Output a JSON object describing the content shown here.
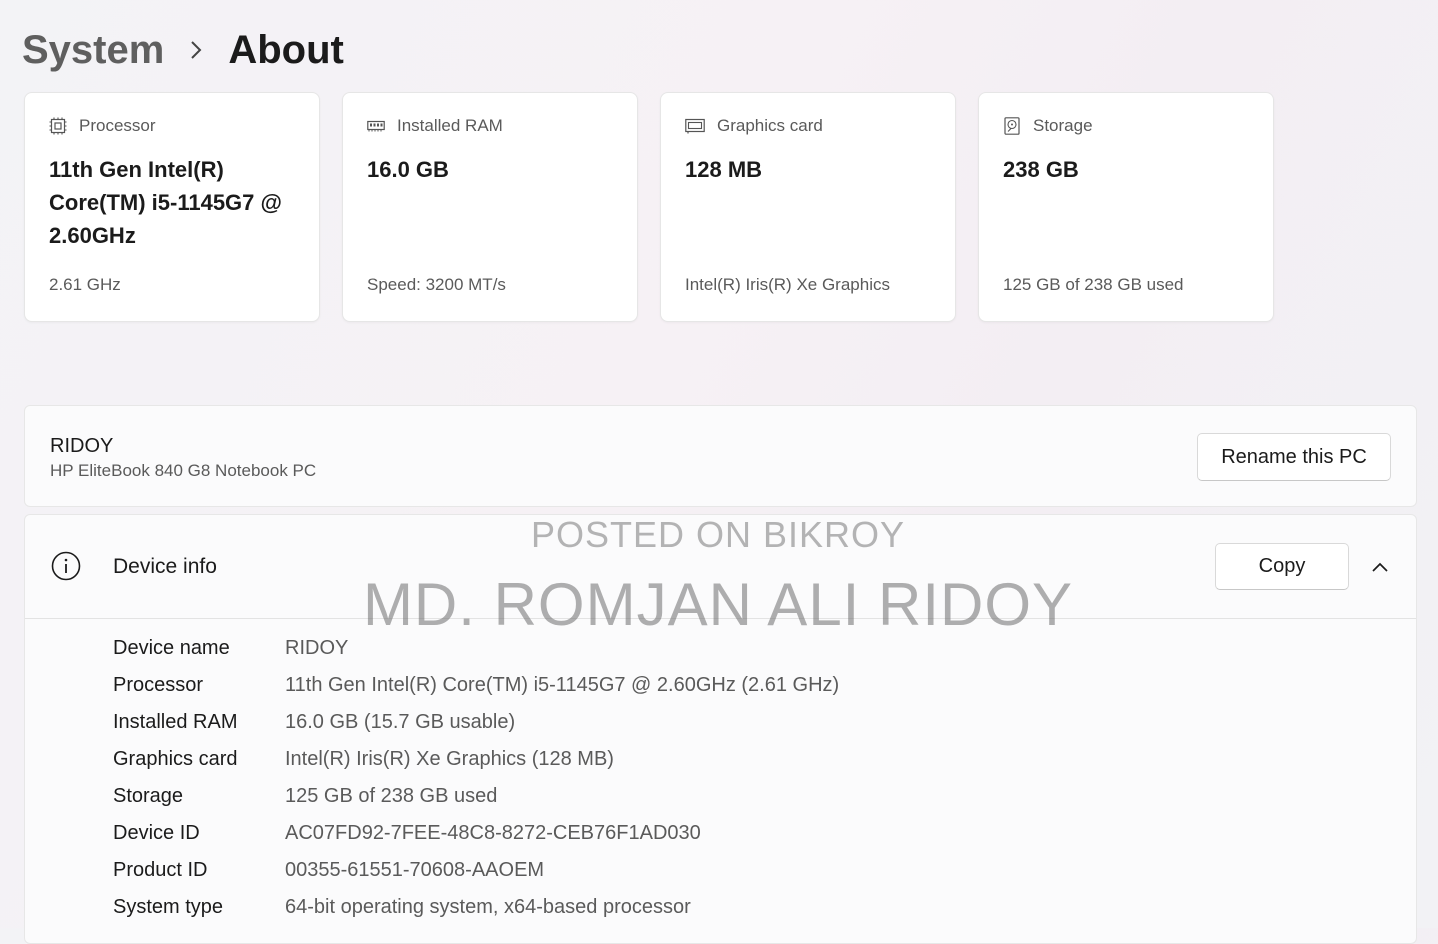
{
  "breadcrumb": {
    "parent": "System",
    "current": "About"
  },
  "cards": [
    {
      "icon": "processor-icon",
      "label": "Processor",
      "value": "11th Gen Intel(R) Core(TM) i5-1145G7 @ 2.60GHz",
      "sub": "2.61 GHz"
    },
    {
      "icon": "ram-icon",
      "label": "Installed RAM",
      "value": "16.0 GB",
      "sub": "Speed: 3200 MT/s"
    },
    {
      "icon": "graphics-card-icon",
      "label": "Graphics card",
      "value": "128 MB",
      "sub": "Intel(R) Iris(R) Xe Graphics"
    },
    {
      "icon": "storage-icon",
      "label": "Storage",
      "value": "238 GB",
      "sub": "125 GB of 238 GB used"
    }
  ],
  "pc": {
    "name": "RIDOY",
    "model": "HP EliteBook 840 G8 Notebook PC",
    "rename_label": "Rename this PC"
  },
  "device_info": {
    "title": "Device info",
    "copy_label": "Copy",
    "rows": [
      {
        "key": "Device name",
        "value": "RIDOY"
      },
      {
        "key": "Processor",
        "value": "11th Gen Intel(R) Core(TM) i5-1145G7 @ 2.60GHz (2.61 GHz)"
      },
      {
        "key": "Installed RAM",
        "value": "16.0 GB (15.7 GB usable)"
      },
      {
        "key": "Graphics card",
        "value": "Intel(R) Iris(R) Xe Graphics (128 MB)"
      },
      {
        "key": "Storage",
        "value": "125 GB of 238 GB used"
      },
      {
        "key": "Device ID",
        "value": "AC07FD92-7FEE-48C8-8272-CEB76F1AD030"
      },
      {
        "key": "Product ID",
        "value": "00355-61551-70608-AAOEM"
      },
      {
        "key": "System type",
        "value": "64-bit operating system, x64-based processor"
      }
    ]
  },
  "watermark": {
    "line1": "POSTED ON BIKROY",
    "line2": "MD. ROMJAN ALI RIDOY"
  }
}
